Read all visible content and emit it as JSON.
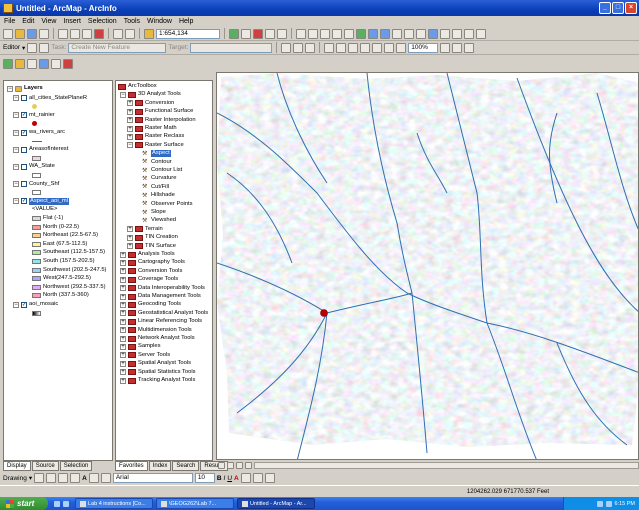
{
  "window": {
    "title": "Untitled - ArcMap - ArcInfo"
  },
  "menu": [
    "File",
    "Edit",
    "View",
    "Insert",
    "Selection",
    "Tools",
    "Window",
    "Help"
  ],
  "toolbar": {
    "scale": "1:654,134",
    "editor_label": "Editor",
    "task_label": "Task:",
    "task_value": "Create New Feature",
    "target_label": "Target:",
    "zoom_value": "100%"
  },
  "toc": {
    "root": "Layers",
    "layers": [
      {
        "name": "all_cities_StatePlaneR",
        "checked": false
      },
      {
        "name": "mt_rainier",
        "checked": true
      },
      {
        "name": "wa_rivers_arc",
        "checked": true
      },
      {
        "name": "AreasofInterest",
        "checked": false
      },
      {
        "name": "WA_State",
        "checked": false
      },
      {
        "name": "County_Shf",
        "checked": false
      },
      {
        "name": "Aspect_aoi_ml",
        "checked": true
      },
      {
        "name": "aoi_mosaic",
        "checked": true
      }
    ],
    "value_header": "<VALUE>",
    "legend": [
      {
        "label": "Flat (-1)",
        "color": "#d9d9d9"
      },
      {
        "label": "North (0-22.5)",
        "color": "#ff9a9a"
      },
      {
        "label": "Northeast (22.5-67.5)",
        "color": "#ffcf8a"
      },
      {
        "label": "East (67.5-112.5)",
        "color": "#fff58a"
      },
      {
        "label": "Southeast (112.5-157.5)",
        "color": "#a8f0a0"
      },
      {
        "label": "South (157.5-202.5)",
        "color": "#8ae8e8"
      },
      {
        "label": "Southwest (202.5-247.5)",
        "color": "#9ad0ff"
      },
      {
        "label": "West(247.5-292.5)",
        "color": "#a8a8ff"
      },
      {
        "label": "Northwest (292.5-337.5)",
        "color": "#e6a8ff"
      },
      {
        "label": "North (337.5-360)",
        "color": "#ff9ab8"
      }
    ],
    "tabs": [
      "Display",
      "Source",
      "Selection"
    ]
  },
  "arctoolbox": {
    "title": "ArcToolbox",
    "tree": [
      {
        "label": "3D Analyst Tools",
        "level": 0,
        "kind": "box",
        "exp": "-"
      },
      {
        "label": "Conversion",
        "level": 1,
        "kind": "box",
        "exp": "+"
      },
      {
        "label": "Functional Surface",
        "level": 1,
        "kind": "box",
        "exp": "+"
      },
      {
        "label": "Raster Interpolation",
        "level": 1,
        "kind": "box",
        "exp": "+"
      },
      {
        "label": "Raster Math",
        "level": 1,
        "kind": "box",
        "exp": "+"
      },
      {
        "label": "Raster Reclass",
        "level": 1,
        "kind": "box",
        "exp": "+"
      },
      {
        "label": "Raster Surface",
        "level": 1,
        "kind": "box",
        "exp": "-"
      },
      {
        "label": "Aspect",
        "level": 2,
        "kind": "tool",
        "selected": true
      },
      {
        "label": "Contour",
        "level": 2,
        "kind": "tool"
      },
      {
        "label": "Contour List",
        "level": 2,
        "kind": "tool"
      },
      {
        "label": "Curvature",
        "level": 2,
        "kind": "tool"
      },
      {
        "label": "Cut/Fill",
        "level": 2,
        "kind": "tool"
      },
      {
        "label": "Hillshade",
        "level": 2,
        "kind": "tool"
      },
      {
        "label": "Observer Points",
        "level": 2,
        "kind": "tool"
      },
      {
        "label": "Slope",
        "level": 2,
        "kind": "tool"
      },
      {
        "label": "Viewshed",
        "level": 2,
        "kind": "tool"
      },
      {
        "label": "Terrain",
        "level": 1,
        "kind": "box",
        "exp": "+"
      },
      {
        "label": "TIN Creation",
        "level": 1,
        "kind": "box",
        "exp": "+"
      },
      {
        "label": "TIN Surface",
        "level": 1,
        "kind": "box",
        "exp": "+"
      },
      {
        "label": "Analysis Tools",
        "level": 0,
        "kind": "box",
        "exp": "+"
      },
      {
        "label": "Cartography Tools",
        "level": 0,
        "kind": "box",
        "exp": "+"
      },
      {
        "label": "Conversion Tools",
        "level": 0,
        "kind": "box",
        "exp": "+"
      },
      {
        "label": "Coverage Tools",
        "level": 0,
        "kind": "box",
        "exp": "+"
      },
      {
        "label": "Data Interoperability Tools",
        "level": 0,
        "kind": "box",
        "exp": "+"
      },
      {
        "label": "Data Management Tools",
        "level": 0,
        "kind": "box",
        "exp": "+"
      },
      {
        "label": "Geocoding Tools",
        "level": 0,
        "kind": "box",
        "exp": "+"
      },
      {
        "label": "Geostatistical Analyst Tools",
        "level": 0,
        "kind": "box",
        "exp": "+"
      },
      {
        "label": "Linear Referencing Tools",
        "level": 0,
        "kind": "box",
        "exp": "+"
      },
      {
        "label": "Multidimension Tools",
        "level": 0,
        "kind": "box",
        "exp": "+"
      },
      {
        "label": "Network Analyst Tools",
        "level": 0,
        "kind": "box",
        "exp": "+"
      },
      {
        "label": "Samples",
        "level": 0,
        "kind": "box",
        "exp": "+"
      },
      {
        "label": "Server Tools",
        "level": 0,
        "kind": "box",
        "exp": "+"
      },
      {
        "label": "Spatial Analyst Tools",
        "level": 0,
        "kind": "box",
        "exp": "+"
      },
      {
        "label": "Spatial Statistics Tools",
        "level": 0,
        "kind": "box",
        "exp": "+"
      },
      {
        "label": "Tracking Analyst Tools",
        "level": 0,
        "kind": "box",
        "exp": "+"
      }
    ],
    "tabs": [
      "Favorites",
      "Index",
      "Search",
      "Results"
    ]
  },
  "drawing": {
    "label": "Drawing",
    "font": "Arial",
    "size": "10",
    "bold": "B",
    "italic": "I",
    "underline": "U"
  },
  "status": {
    "coords": "1204262.029  671770.537 Feet"
  },
  "taskbar": {
    "start": "start",
    "items": [
      {
        "label": "Lab 4 instructions [Co...",
        "active": false
      },
      {
        "label": "\\GEOG262\\Lab 7...",
        "active": false
      },
      {
        "label": "Untitled - ArcMap - Ar...",
        "active": true
      }
    ],
    "clock": "6:15 PM"
  },
  "colors": {
    "titlebar": "#0a3fb8",
    "rivers": "#2e6fb0",
    "point": "#c00000"
  }
}
